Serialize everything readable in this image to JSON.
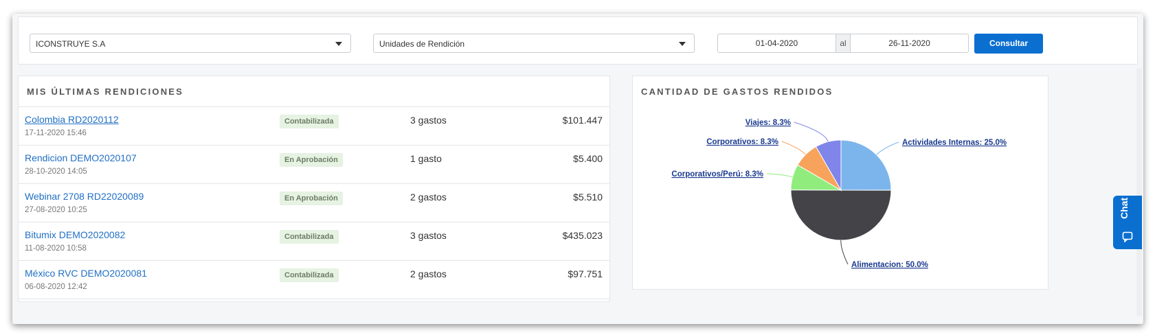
{
  "filters": {
    "company": "ICONSTRUYE S.A",
    "units": "Unidades de Rendición",
    "date_from": "01-04-2020",
    "date_sep": "al",
    "date_to": "26-11-2020",
    "submit_label": "Consultar"
  },
  "rendiciones": {
    "title": "MIS ÚLTIMAS RENDICIONES",
    "rows": [
      {
        "name": "Colombia RD2020112",
        "date": "17-11-2020 15:46",
        "status": "Contabilizada",
        "count": "3 gastos",
        "amount": "$101.447"
      },
      {
        "name": "Rendicion DEMO2020107",
        "date": "28-10-2020 14:05",
        "status": "En Aprobación",
        "count": "1 gasto",
        "amount": "$5.400"
      },
      {
        "name": "Webinar 2708 RD22020089",
        "date": "27-08-2020 10:25",
        "status": "En Aprobación",
        "count": "2 gastos",
        "amount": "$5.510"
      },
      {
        "name": "Bitumix DEMO2020082",
        "date": "11-08-2020 10:58",
        "status": "Contabilizada",
        "count": "3 gastos",
        "amount": "$435.023"
      },
      {
        "name": "México RVC DEMO2020081",
        "date": "06-08-2020 12:42",
        "status": "Contabilizada",
        "count": "2 gastos",
        "amount": "$97.751"
      }
    ]
  },
  "gastos_panel": {
    "title": "CANTIDAD DE GASTOS RENDIDOS"
  },
  "chart_data": {
    "type": "pie",
    "slices": [
      {
        "label": "Actividades Internas: 25.0%",
        "value": 25.0,
        "color": "#7cb5ec"
      },
      {
        "label": "Alimentacion: 50.0%",
        "value": 50.0,
        "color": "#434348"
      },
      {
        "label": "Corporativos/Perú: 8.3%",
        "value": 8.3,
        "color": "#90ed7d"
      },
      {
        "label": "Corporativos: 8.3%",
        "value": 8.3,
        "color": "#f7a35c"
      },
      {
        "label": "Viajes: 8.3%",
        "value": 8.3,
        "color": "#8085e9"
      }
    ]
  },
  "chat": {
    "label": "Chat"
  },
  "colors": {
    "primary": "#0b6fd0",
    "link": "#1f6fc4",
    "label": "#1a3a8f"
  }
}
